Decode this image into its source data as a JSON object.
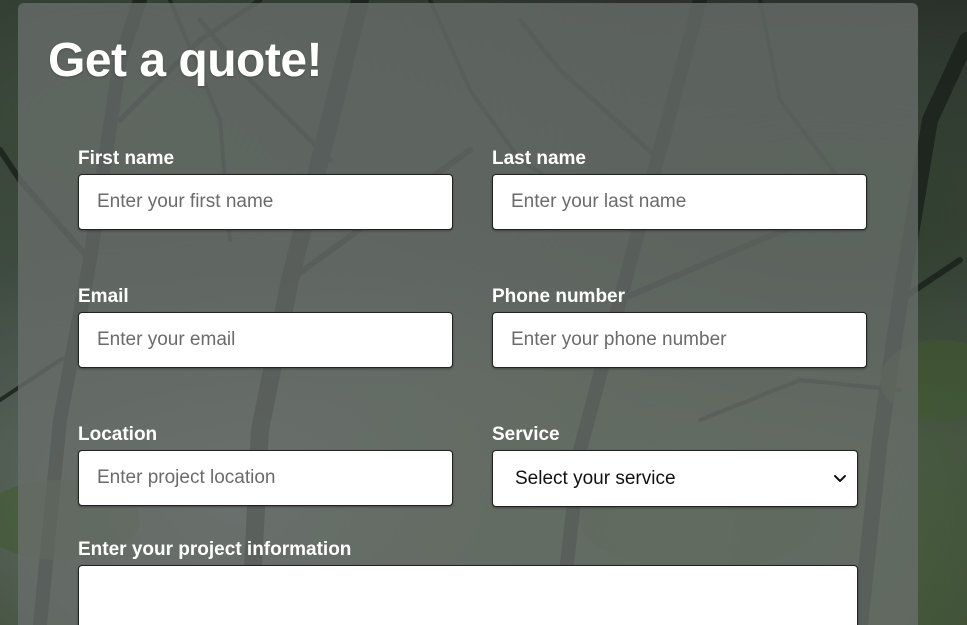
{
  "form": {
    "title": "Get a quote!",
    "first_name": {
      "label": "First name",
      "placeholder": "Enter your first name",
      "value": ""
    },
    "last_name": {
      "label": "Last name",
      "placeholder": "Enter your last name",
      "value": ""
    },
    "email": {
      "label": "Email",
      "placeholder": "Enter your email",
      "value": ""
    },
    "phone": {
      "label": "Phone number",
      "placeholder": "Enter your phone number",
      "value": ""
    },
    "location": {
      "label": "Location",
      "placeholder": "Enter project location",
      "value": ""
    },
    "service": {
      "label": "Service",
      "selected": "Select your service"
    },
    "project_info": {
      "label": "Enter your project information",
      "value": ""
    }
  },
  "icons": {
    "service_dropdown": "chevron-down-icon"
  }
}
